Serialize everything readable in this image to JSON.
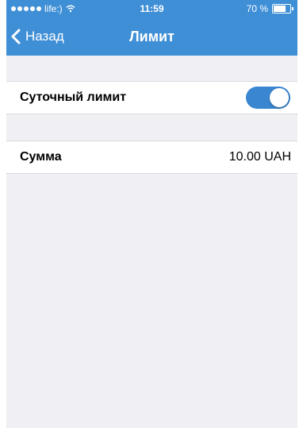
{
  "status_bar": {
    "carrier": "life:)",
    "time": "11:59",
    "battery": "70 %",
    "battery_level": 0.7
  },
  "nav": {
    "back_label": "Назад",
    "title": "Лимит"
  },
  "settings": {
    "daily_limit_label": "Суточный лимит",
    "daily_limit_enabled": true,
    "amount_label": "Сумма",
    "amount_value": "10.00 UAH"
  },
  "colors": {
    "accent": "#3f8fd6",
    "toggle_on": "#3a86d0",
    "background": "#efeff4"
  },
  "icons": {
    "back": "chevron-left-icon",
    "wifi": "wifi-icon",
    "battery": "battery-icon",
    "signal": "signal-dots-icon"
  }
}
